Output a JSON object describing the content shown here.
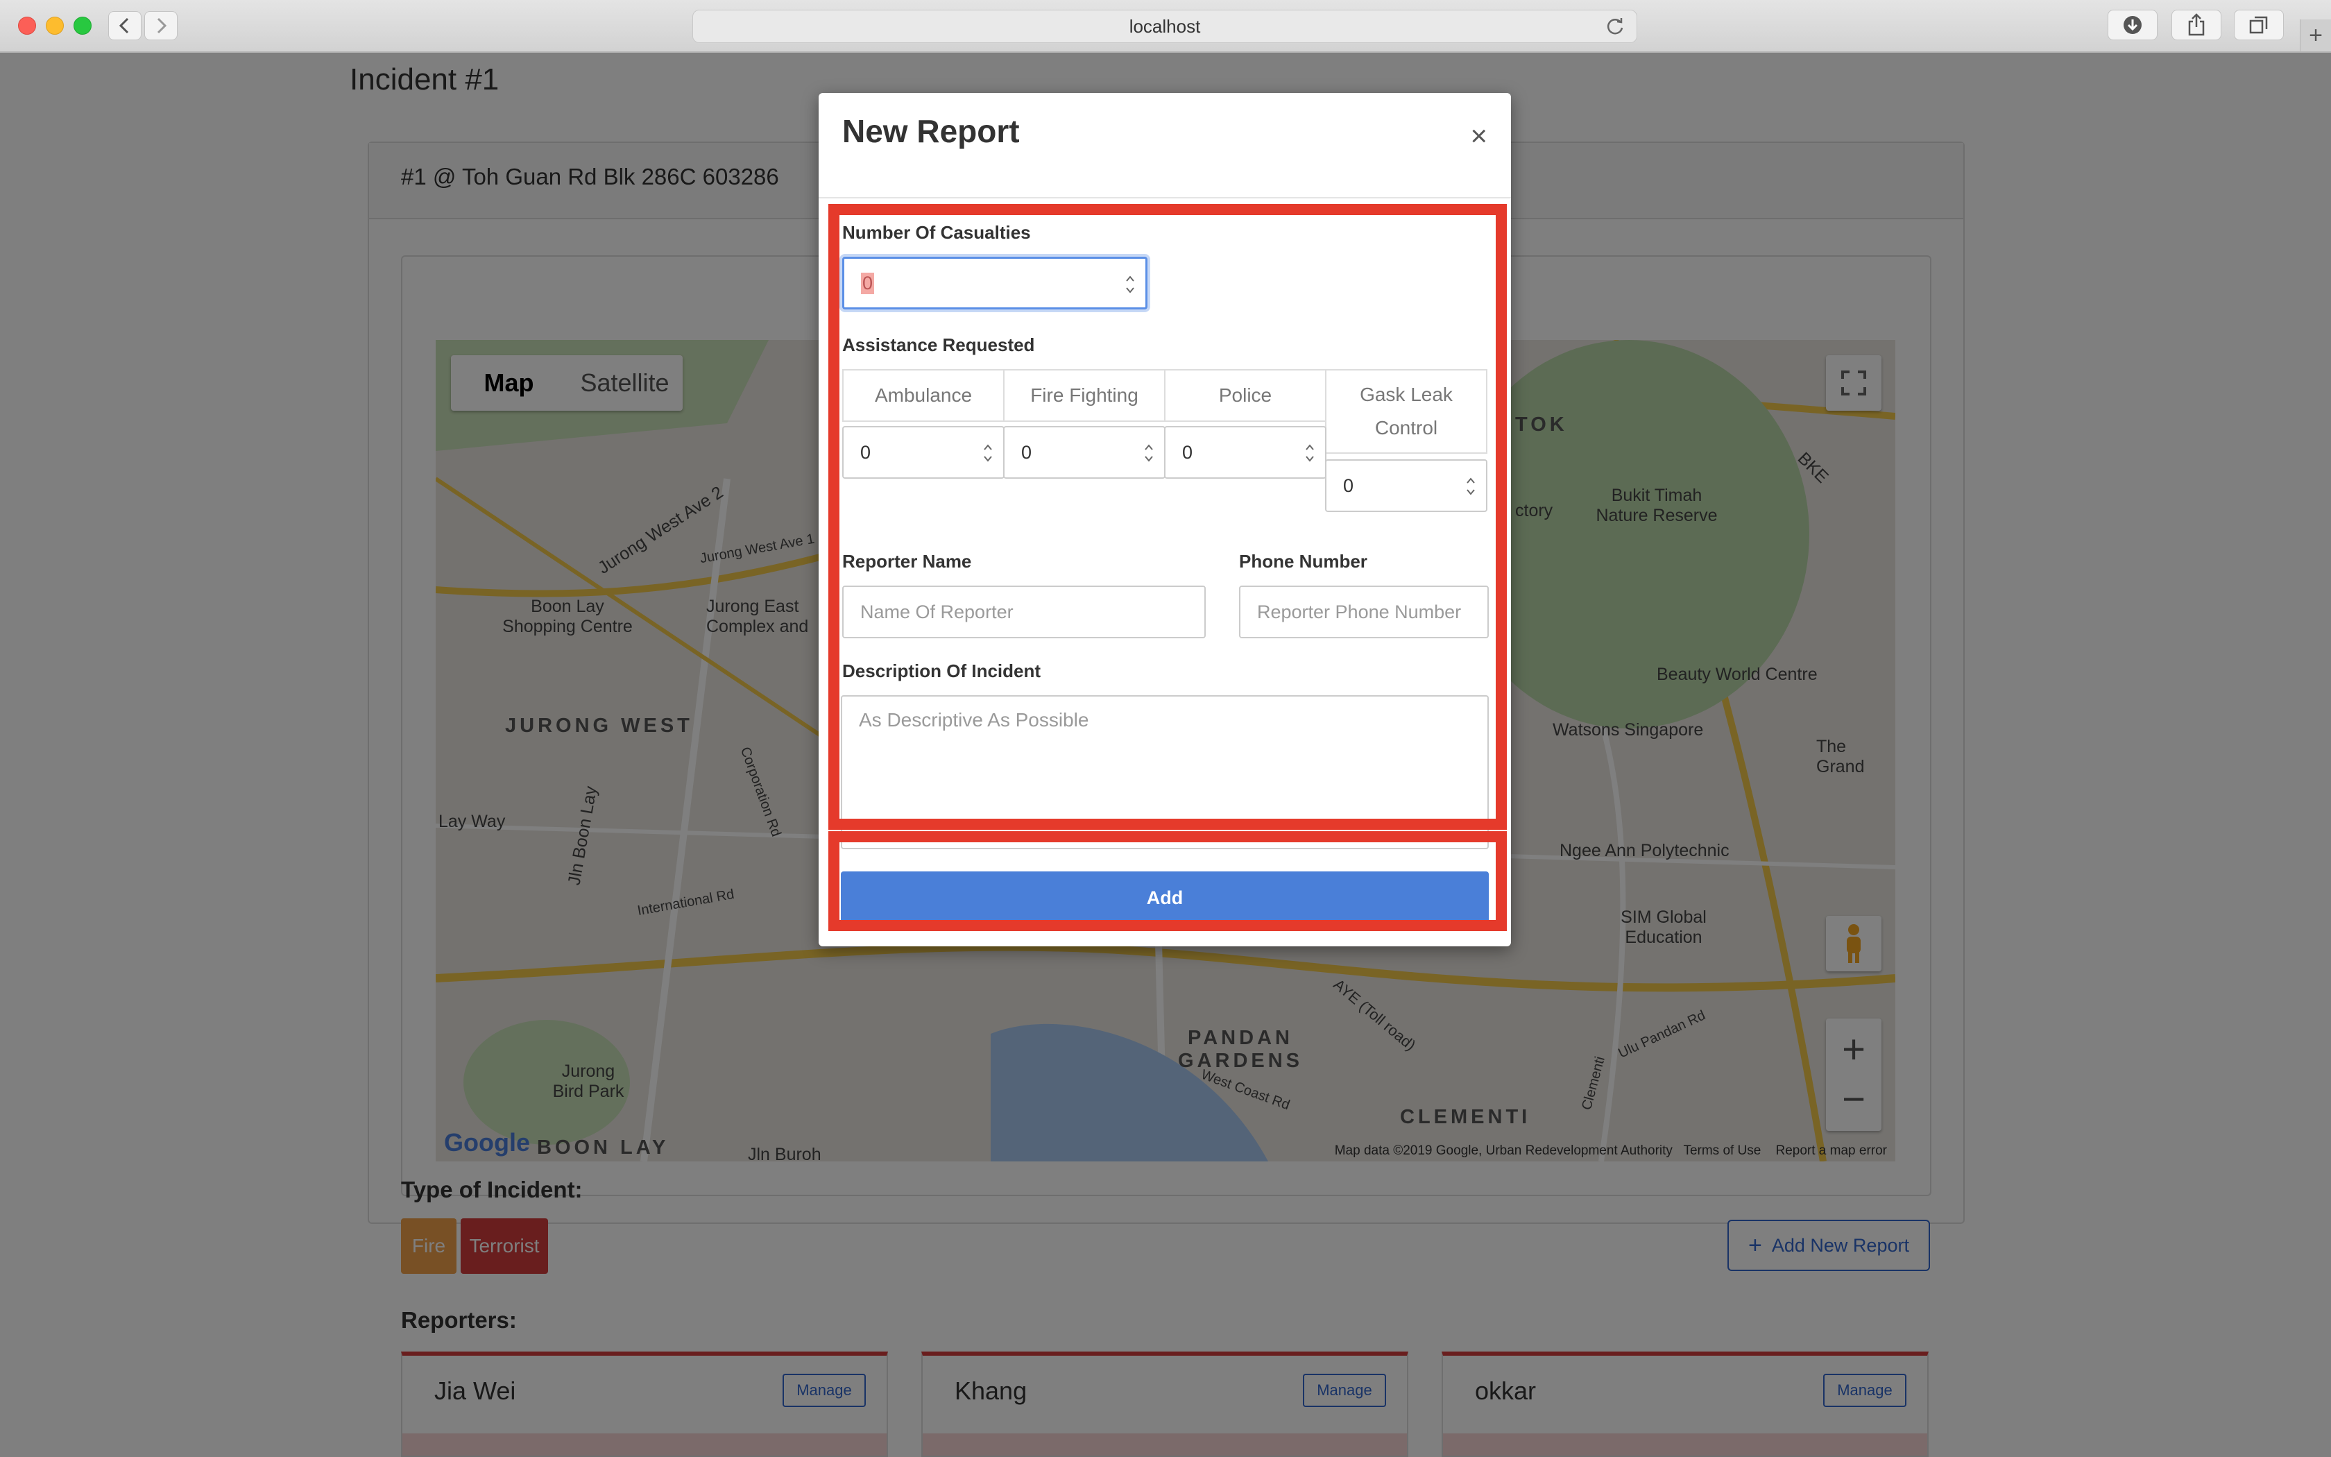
{
  "browser": {
    "url": "localhost"
  },
  "page": {
    "title": "Incident #1",
    "incident_address": "#1 @ Toh Guan Rd Blk 286C 603286",
    "map": {
      "type_options": [
        "Map",
        "Satellite"
      ],
      "labels": [
        "Jurong West Ave 2",
        "Jurong West Ave 1",
        "Boon Lay Shopping Centre",
        "Jurong East Complex and",
        "JURONG WEST",
        "Corporation Rd",
        "Lay Way",
        "Jln Boon Lay",
        "International Rd",
        "Jurong Bird Park",
        "BOON LAY",
        "Jln Buroh",
        "PANDAN GARDENS",
        "AYE (Toll road)",
        "West Coast Rd",
        "CLEMENTI",
        "Bukit Timah Nature Reserve",
        "Beauty World Centre",
        "Watsons Singapore",
        "The Grand",
        "Ngee Ann Polytechnic",
        "SIM Global Education",
        "BKE",
        "TOK",
        "ctory",
        "Ulu Pandan Rd",
        "Clementi"
      ],
      "footer": "Map data ©2019 Google, Urban Redevelopment Authority",
      "terms": "Terms of Use",
      "report_error": "Report a map error",
      "logo": "Google"
    },
    "type_of_incident_label": "Type of Incident:",
    "tags": [
      "Fire",
      "Terrorist"
    ],
    "add_new_report": "Add New Report",
    "reporters_label": "Reporters:",
    "reporters": [
      {
        "name": "Jia Wei",
        "action": "Manage"
      },
      {
        "name": "Khang",
        "action": "Manage"
      },
      {
        "name": "okkar",
        "action": "Manage"
      }
    ]
  },
  "modal": {
    "title": "New Report",
    "close": "×",
    "casualties_label": "Number Of Casualties",
    "casualties_value": "0",
    "assistance_label": "Assistance Requested",
    "assistance": [
      {
        "label": "Ambulance",
        "value": "0"
      },
      {
        "label": "Fire Fighting",
        "value": "0"
      },
      {
        "label": "Police",
        "value": "0"
      },
      {
        "label": "Gask Leak Control",
        "value": "0"
      }
    ],
    "reporter_name_label": "Reporter Name",
    "reporter_name_placeholder": "Name Of Reporter",
    "phone_label": "Phone Number",
    "phone_placeholder": "Reporter Phone Number",
    "description_label": "Description Of Incident",
    "description_placeholder": "As Descriptive As Possible",
    "submit": "Add"
  }
}
